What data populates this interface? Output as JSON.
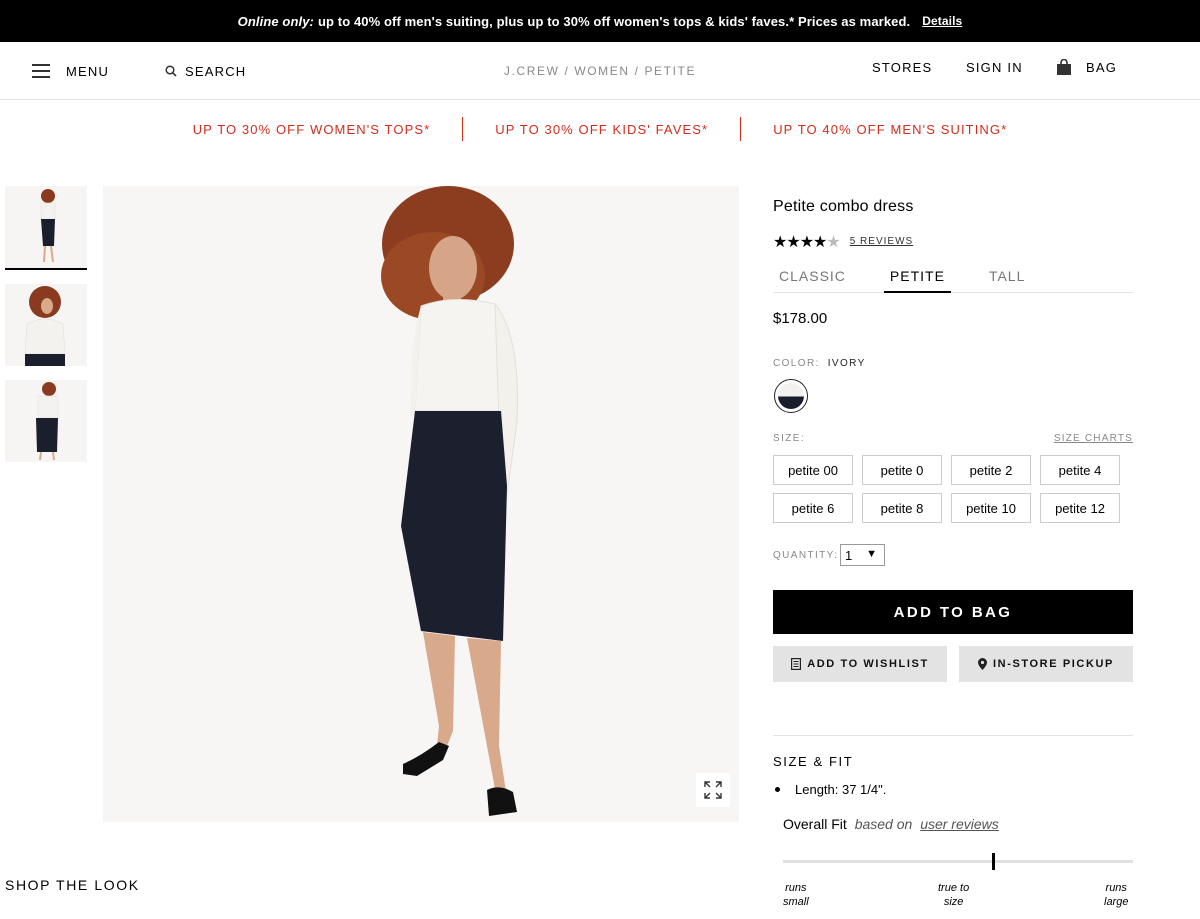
{
  "promo_bar": {
    "lead": "Online only:",
    "text": "up to 40% off men's suiting, plus up to 30% off women's tops & kids' faves.* Prices as marked.",
    "details": "Details"
  },
  "header": {
    "menu": "MENU",
    "search": "SEARCH",
    "breadcrumb": "J.CREW / WOMEN / PETITE",
    "stores": "STORES",
    "sign_in": "SIGN IN",
    "bag": "BAG"
  },
  "promos": [
    "UP TO 30% OFF WOMEN'S TOPS*",
    "UP TO 30% OFF KIDS' FAVES*",
    "UP TO 40% OFF MEN'S SUITING*"
  ],
  "product": {
    "title": "Petite combo dress",
    "rating": 4,
    "rating_max": 5,
    "stars_on": "★★★★",
    "stars_off": "★",
    "reviews": "5 REVIEWS",
    "fit_tabs": [
      "CLASSIC",
      "PETITE",
      "TALL"
    ],
    "active_fit": "PETITE",
    "price": "$178.00",
    "color_label": "COLOR:",
    "color_value": "IVORY",
    "size_label": "SIZE:",
    "size_charts": "SIZE CHARTS",
    "sizes": [
      "petite 00",
      "petite 0",
      "petite 2",
      "petite 4",
      "petite 6",
      "petite 8",
      "petite 10",
      "petite 12"
    ],
    "quantity_label": "QUANTITY:",
    "quantity": "1",
    "add_to_bag": "ADD TO BAG",
    "add_to_wishlist": "ADD TO WISHLIST",
    "in_store_pickup": "IN-STORE PICKUP"
  },
  "size_fit": {
    "title": "SIZE & FIT",
    "bullet": "Length: 37 1/4\".",
    "overall_fit": "Overall Fit",
    "based_on": "based on",
    "user_reviews": "user reviews",
    "fit_position": 0.6,
    "label_small_1": "runs",
    "label_small_2": "small",
    "label_true_1": "true to",
    "label_true_2": "size",
    "label_large_1": "runs",
    "label_large_2": "large"
  },
  "shop_the_look": "SHOP THE LOOK",
  "colors": {
    "accent_red": "#d22d1c",
    "black": "#000000"
  },
  "icons": {
    "menu": "hamburger-icon",
    "search": "search-icon",
    "bag": "bag-icon",
    "zoom": "expand-icon",
    "wishlist": "list-icon",
    "pickup": "location-pin-icon"
  }
}
